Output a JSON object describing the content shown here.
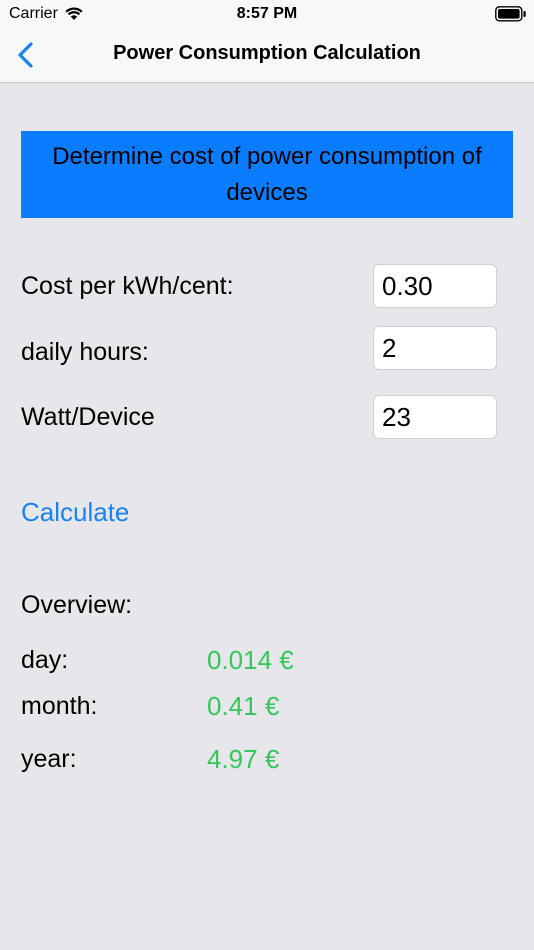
{
  "status_bar": {
    "carrier": "Carrier",
    "time": "8:57 PM"
  },
  "nav": {
    "title": "Power Consumption Calculation",
    "back_icon": "chevron-left-icon"
  },
  "banner": {
    "text": "Determine cost of power consumption of devices",
    "color": "#0a7cff"
  },
  "inputs": {
    "cost_label": "Cost per kWh/cent:",
    "cost_value": "0.30",
    "hours_label": "daily hours:",
    "hours_value": "2",
    "watt_label": "Watt/Device",
    "watt_value": "23"
  },
  "calculate_label": "Calculate",
  "overview": {
    "title": "Overview:",
    "day_label": "day:",
    "day_value": "0.014 €",
    "month_label": "month:",
    "month_value": "0.41 €",
    "year_label": "year:",
    "year_value": "4.97 €",
    "value_color": "#34c759"
  },
  "accent_color": "#1a82f7"
}
